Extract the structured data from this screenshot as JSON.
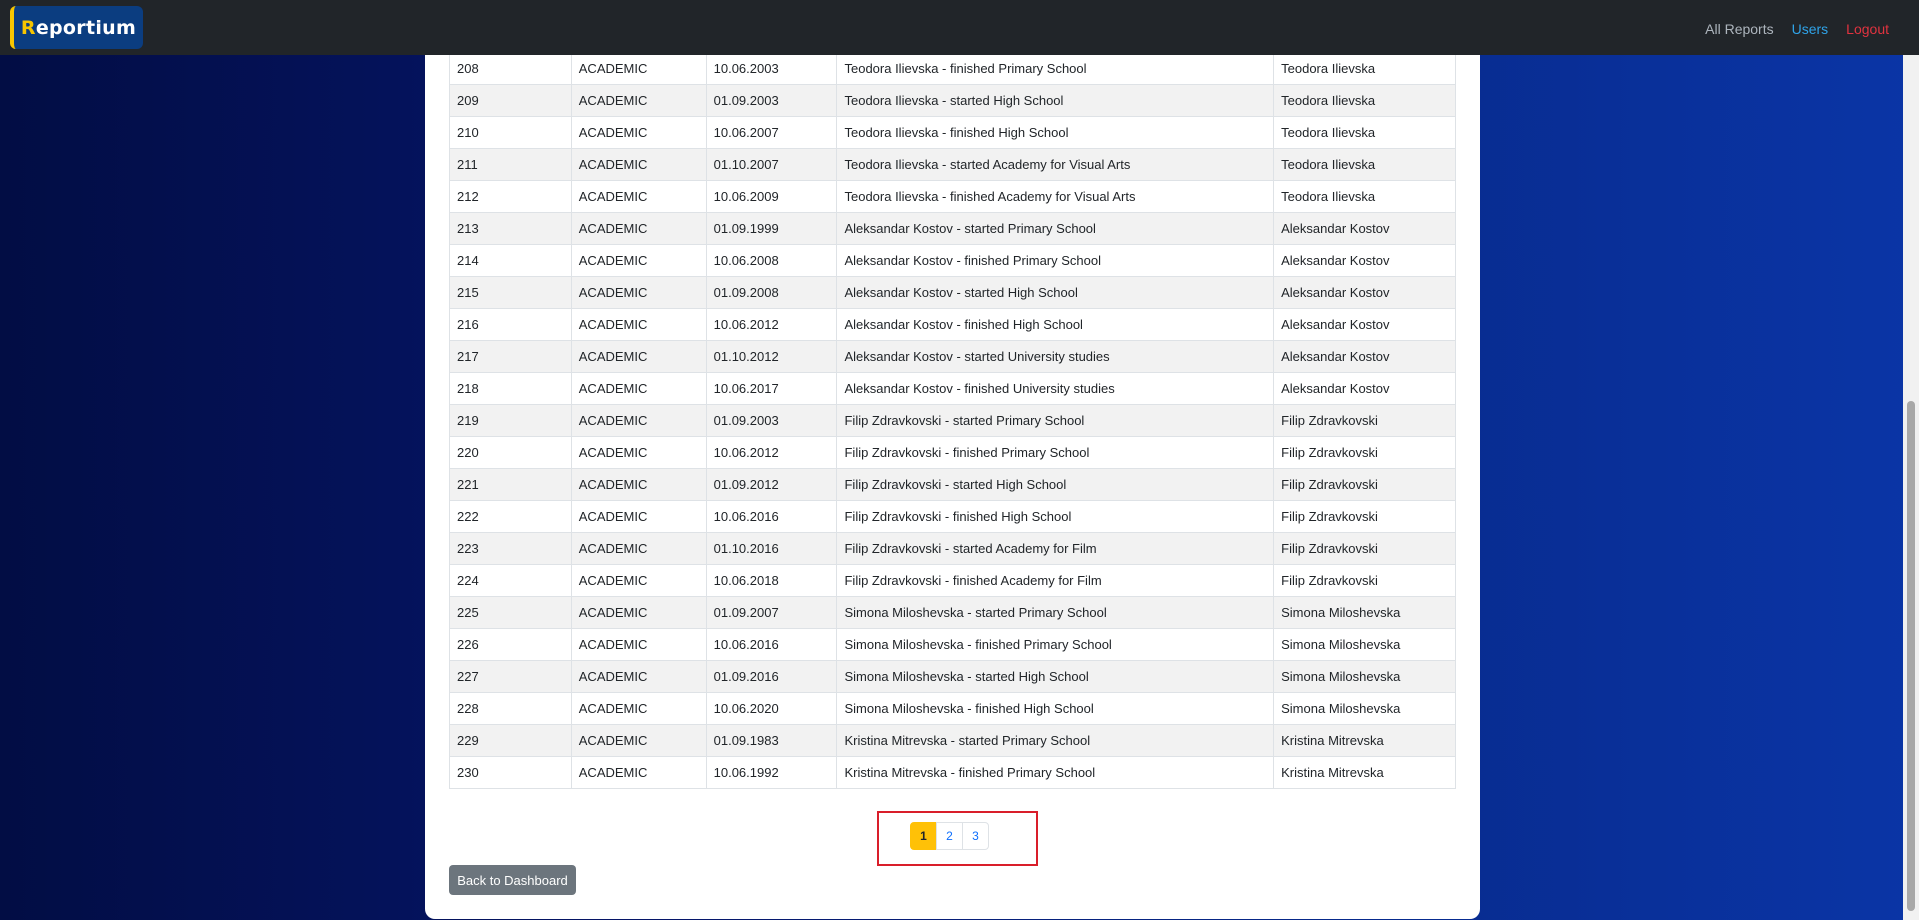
{
  "navbar": {
    "brand": {
      "first": "R",
      "rest": "eportium"
    },
    "links": {
      "all_reports": "All Reports",
      "users": "Users",
      "logout": "Logout"
    }
  },
  "colors": {
    "navbar_bg": "#212529",
    "brand_bg": "#0b3d80",
    "brand_accent": "#f7c600",
    "users_link": "#2fa3e8",
    "logout_link": "#e0333f",
    "active_page": "#ffc107",
    "highlight": "#d91e2a"
  },
  "table": {
    "rows": [
      [
        "208",
        "ACADEMIC",
        "10.06.2003",
        "Teodora Ilievska - finished Primary School",
        "Teodora Ilievska"
      ],
      [
        "209",
        "ACADEMIC",
        "01.09.2003",
        "Teodora Ilievska - started High School",
        "Teodora Ilievska"
      ],
      [
        "210",
        "ACADEMIC",
        "10.06.2007",
        "Teodora Ilievska - finished High School",
        "Teodora Ilievska"
      ],
      [
        "211",
        "ACADEMIC",
        "01.10.2007",
        "Teodora Ilievska - started Academy for Visual Arts",
        "Teodora Ilievska"
      ],
      [
        "212",
        "ACADEMIC",
        "10.06.2009",
        "Teodora Ilievska - finished Academy for Visual Arts",
        "Teodora Ilievska"
      ],
      [
        "213",
        "ACADEMIC",
        "01.09.1999",
        "Aleksandar Kostov - started Primary School",
        "Aleksandar Kostov"
      ],
      [
        "214",
        "ACADEMIC",
        "10.06.2008",
        "Aleksandar Kostov - finished Primary School",
        "Aleksandar Kostov"
      ],
      [
        "215",
        "ACADEMIC",
        "01.09.2008",
        "Aleksandar Kostov - started High School",
        "Aleksandar Kostov"
      ],
      [
        "216",
        "ACADEMIC",
        "10.06.2012",
        "Aleksandar Kostov - finished High School",
        "Aleksandar Kostov"
      ],
      [
        "217",
        "ACADEMIC",
        "01.10.2012",
        "Aleksandar Kostov - started University studies",
        "Aleksandar Kostov"
      ],
      [
        "218",
        "ACADEMIC",
        "10.06.2017",
        "Aleksandar Kostov - finished University studies",
        "Aleksandar Kostov"
      ],
      [
        "219",
        "ACADEMIC",
        "01.09.2003",
        "Filip Zdravkovski - started Primary School",
        "Filip Zdravkovski"
      ],
      [
        "220",
        "ACADEMIC",
        "10.06.2012",
        "Filip Zdravkovski - finished Primary School",
        "Filip Zdravkovski"
      ],
      [
        "221",
        "ACADEMIC",
        "01.09.2012",
        "Filip Zdravkovski - started High School",
        "Filip Zdravkovski"
      ],
      [
        "222",
        "ACADEMIC",
        "10.06.2016",
        "Filip Zdravkovski - finished High School",
        "Filip Zdravkovski"
      ],
      [
        "223",
        "ACADEMIC",
        "01.10.2016",
        "Filip Zdravkovski - started Academy for Film",
        "Filip Zdravkovski"
      ],
      [
        "224",
        "ACADEMIC",
        "10.06.2018",
        "Filip Zdravkovski - finished Academy for Film",
        "Filip Zdravkovski"
      ],
      [
        "225",
        "ACADEMIC",
        "01.09.2007",
        "Simona Miloshevska - started Primary School",
        "Simona Miloshevska"
      ],
      [
        "226",
        "ACADEMIC",
        "10.06.2016",
        "Simona Miloshevska - finished Primary School",
        "Simona Miloshevska"
      ],
      [
        "227",
        "ACADEMIC",
        "01.09.2016",
        "Simona Miloshevska - started High School",
        "Simona Miloshevska"
      ],
      [
        "228",
        "ACADEMIC",
        "10.06.2020",
        "Simona Miloshevska - finished High School",
        "Simona Miloshevska"
      ],
      [
        "229",
        "ACADEMIC",
        "01.09.1983",
        "Kristina Mitrevska - started Primary School",
        "Kristina Mitrevska"
      ],
      [
        "230",
        "ACADEMIC",
        "10.06.1992",
        "Kristina Mitrevska - finished Primary School",
        "Kristina Mitrevska"
      ]
    ]
  },
  "pagination": {
    "pages": [
      "1",
      "2",
      "3"
    ],
    "active": "1"
  },
  "back_button": "Back to Dashboard"
}
